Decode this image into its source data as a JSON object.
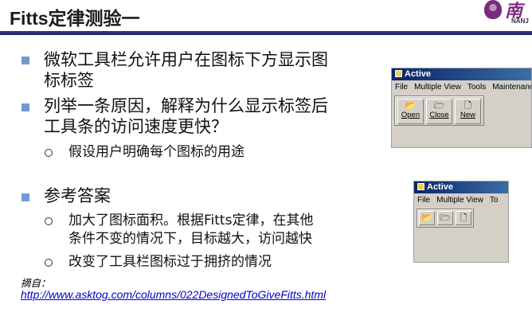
{
  "slide": {
    "title": "Fitts定律测验一",
    "logo": {
      "text": "南",
      "sub": "NANJ"
    },
    "bullets": [
      {
        "line1": "微软工具栏允许用户在图标下方显示图",
        "line2": "标标签"
      },
      {
        "line1": "列举一条原因，解释为什么显示标签后",
        "line2": "工具条的访问速度更快？"
      }
    ],
    "sub_bullet_1": "假设用户明确每个图标的用途",
    "answer_heading": "参考答案",
    "answers": [
      {
        "line1": "加大了图标面积。根据Fitts定律，在其他",
        "line2": "条件不变的情况下，目标越大，访问越快"
      },
      {
        "line1": "改变了工具栏图标过于拥挤的情况"
      }
    ],
    "ref_label": "摘自：",
    "ref_link": "http://www.asktog.com/columns/022DesignedToGiveFitts.html"
  },
  "window_large": {
    "title": "Active",
    "menu": [
      "File",
      "Multiple View",
      "Tools",
      "Maintenanc"
    ],
    "buttons": [
      {
        "icon": "open-icon",
        "glyph": "📂",
        "label": "Open"
      },
      {
        "icon": "close-icon",
        "glyph": "🗁",
        "label": "Close"
      },
      {
        "icon": "new-icon",
        "glyph": "🗋",
        "label": "New"
      }
    ]
  },
  "window_small": {
    "title": "Active",
    "menu": [
      "File",
      "Multiple View",
      "To"
    ],
    "buttons": [
      {
        "icon": "open-icon",
        "glyph": "📂"
      },
      {
        "icon": "close-icon",
        "glyph": "🗁"
      },
      {
        "icon": "new-icon",
        "glyph": "🗋"
      }
    ]
  },
  "colors": {
    "bullet": "#6d9bd1",
    "title_rule": "#1f1f5a",
    "logo": "#7a2a7e",
    "link": "#0000cc"
  }
}
